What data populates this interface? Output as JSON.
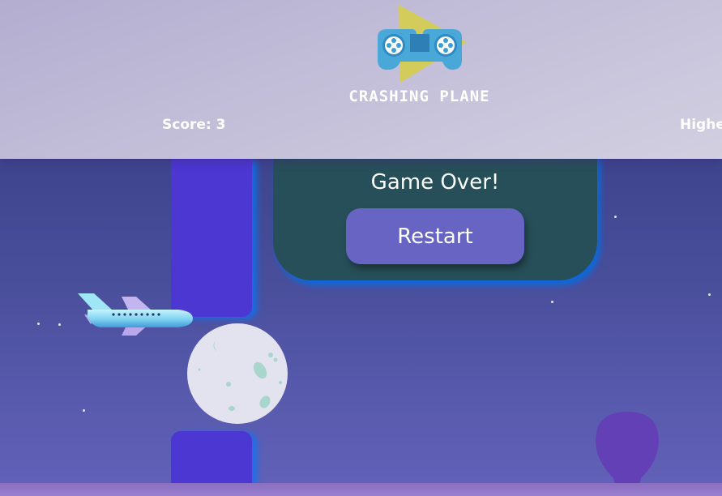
{
  "header": {
    "game_title": "CRASHING PLANE",
    "score_text": "Score: 3",
    "high_score_text": "Highe",
    "logo_icon": "gamepad-play-logo"
  },
  "modal": {
    "title": "Game Over!",
    "restart_label": "Restart"
  },
  "scene": {
    "player_icon": "airplane-icon",
    "obstacle_color": "#4c37d2",
    "obstacle_glow": "#0078ff",
    "sky_color": "#4a4f9c",
    "moon_icon": "moon-icon",
    "balloon_icon": "balloon-icon"
  }
}
